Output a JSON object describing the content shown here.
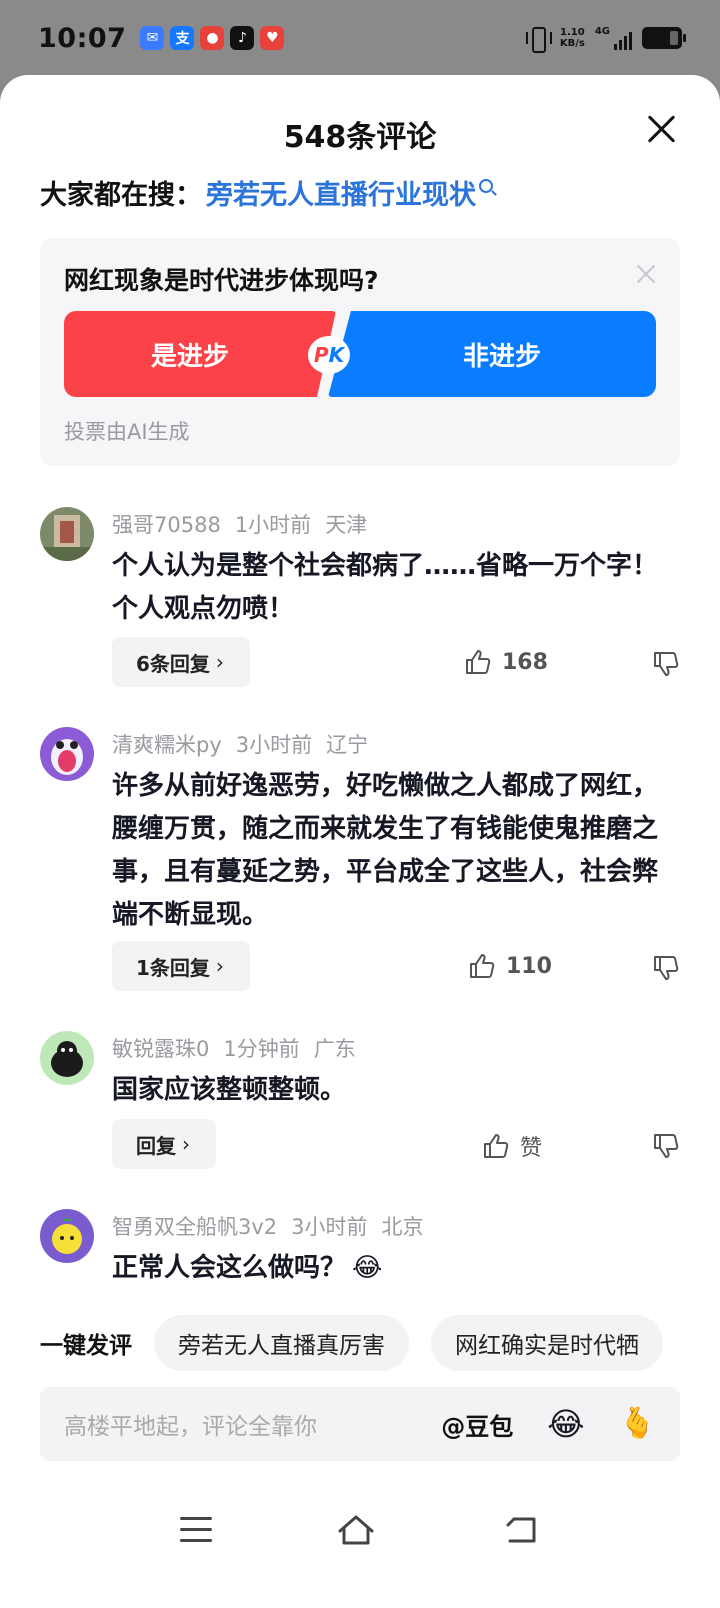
{
  "status_bar": {
    "time": "10:07",
    "speed_value": "1.10",
    "speed_unit": "KB/s",
    "network": "4G",
    "apps": [
      {
        "name": "app-icon-blue",
        "color": "#3a7bff",
        "glyph": "✉"
      },
      {
        "name": "alipay-icon",
        "color": "#1677ff",
        "glyph": "支"
      },
      {
        "name": "app-icon-red",
        "color": "#e8413a",
        "glyph": "●"
      },
      {
        "name": "tiktok-icon",
        "color": "#111111",
        "glyph": "♪"
      },
      {
        "name": "app-icon-heart",
        "color": "#e8413a",
        "glyph": "♥"
      }
    ]
  },
  "sheet": {
    "title": "548条评论",
    "search_prefix": "大家都在搜：",
    "search_term": "旁若无人直播行业现状"
  },
  "poll": {
    "question": "网红现象是时代进步体现吗?",
    "option_yes": "是进步",
    "option_no": "非进步",
    "pk_p": "P",
    "pk_k": "K",
    "footnote": "投票由AI生成",
    "colors": {
      "yes": "#fc4249",
      "no": "#0a7cff"
    }
  },
  "comments": [
    {
      "user": "强哥70588",
      "time": "1小时前",
      "location": "天津",
      "text": "个人认为是整个社会都病了……省略一万个字！个人观点勿喷！",
      "reply_label": "6条回复",
      "likes": "168"
    },
    {
      "user": "清爽糯米py",
      "time": "3小时前",
      "location": "辽宁",
      "text": "许多从前好逸恶劳，好吃懒做之人都成了网红，腰缠万贯，随之而来就发生了有钱能使鬼推磨之事，且有蔓延之势，平台成全了这些人，社会弊端不断显现。",
      "reply_label": "1条回复",
      "likes": "110"
    },
    {
      "user": "敏锐露珠0",
      "time": "1分钟前",
      "location": "广东",
      "text": "国家应该整顿整顿。",
      "reply_label": "回复",
      "likes": "赞"
    },
    {
      "user": "智勇双全船帆3v2",
      "time": "3小时前",
      "location": "北京",
      "text": "正常人会这么做吗？",
      "emoji": "😂"
    }
  ],
  "quick_replies": {
    "label": "一键发评",
    "chips": [
      "旁若无人直播真厉害",
      "网红确实是时代牺"
    ]
  },
  "input": {
    "placeholder": "高楼平地起，评论全靠你",
    "mention": "@豆包",
    "emoji": "😂",
    "heart": "🫰"
  }
}
